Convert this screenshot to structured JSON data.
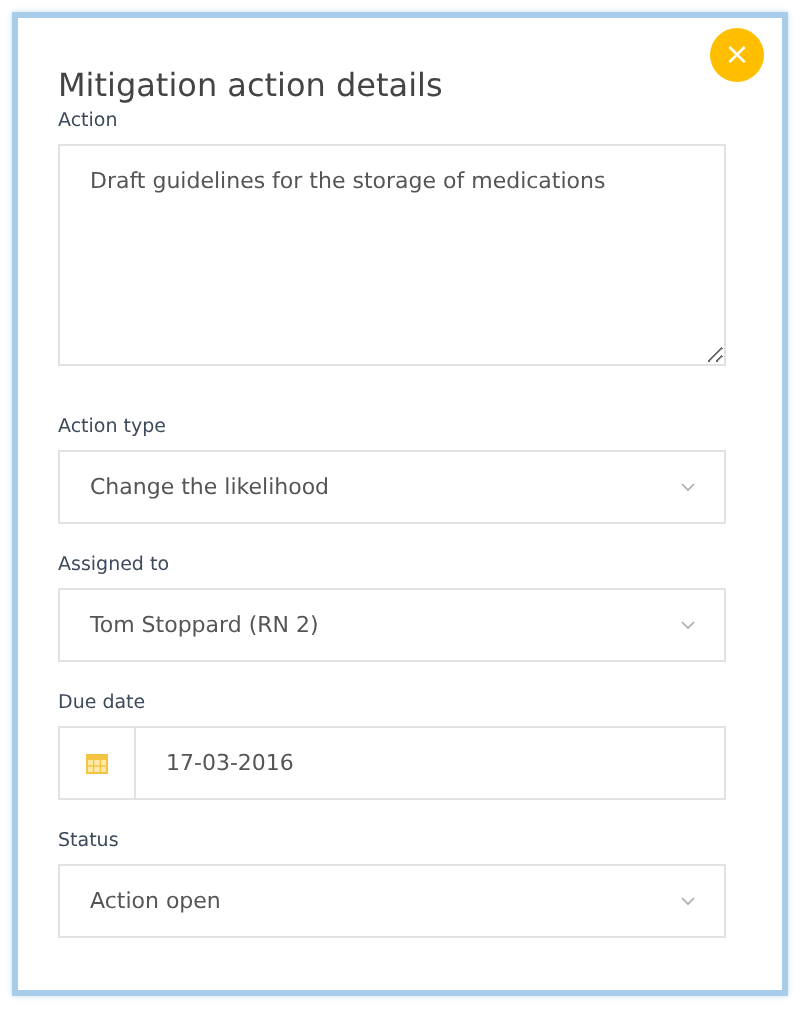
{
  "dialog": {
    "title": "Mitigation action details",
    "close_label": "×"
  },
  "fields": [
    {
      "kind": "textarea",
      "label": "Action",
      "value": "Draft guidelines for the storage of medications"
    },
    {
      "kind": "select",
      "label": "Action type",
      "value": "Change the likelihood"
    },
    {
      "kind": "select",
      "label": "Assigned to",
      "value": "Tom Stoppard (RN 2)"
    },
    {
      "kind": "date",
      "label": "Due date",
      "value": "17-03-2016"
    },
    {
      "kind": "select",
      "label": "Status",
      "value": "Action open"
    }
  ]
}
